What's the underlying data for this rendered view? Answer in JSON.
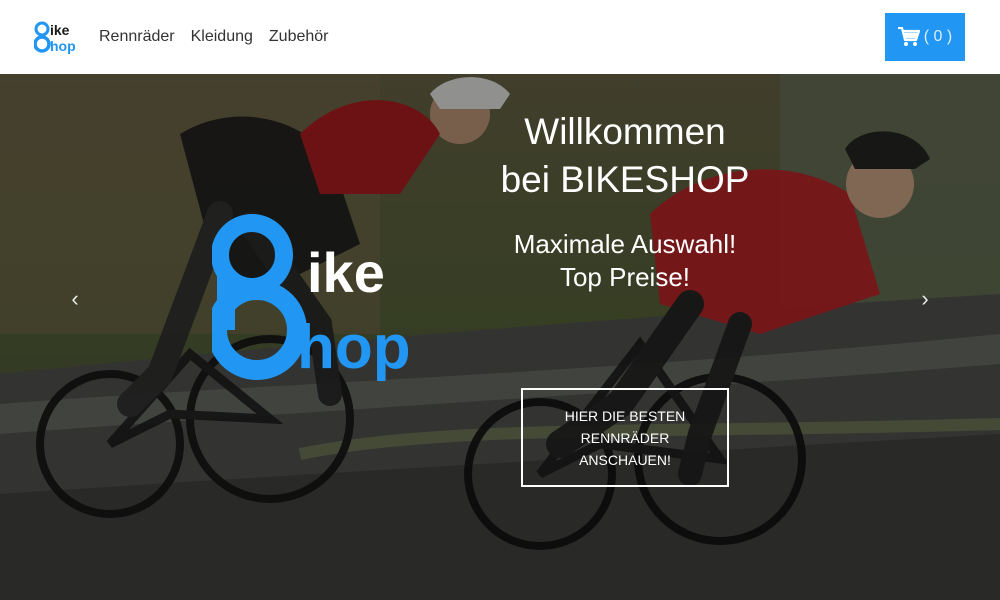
{
  "header": {
    "logo": {
      "text_line1": "ike",
      "text_line2": "hop",
      "icon": "bikeshop-logo-icon"
    },
    "nav": [
      {
        "label": "Rennräder"
      },
      {
        "label": "Kleidung"
      },
      {
        "label": "Zubehör"
      }
    ],
    "cart": {
      "icon": "shopping-cart-icon",
      "count_label": "( 0 )"
    }
  },
  "hero": {
    "logo": {
      "text_line1": "ike",
      "text_line2": "hop"
    },
    "title": "Willkommen bei BIKESHOP",
    "subtitle": "Maximale Auswahl! Top Preise!",
    "cta_label": "HIER DIE BESTEN RENNRÄDER ANSCHAUEN!",
    "prev_glyph": "‹",
    "next_glyph": "›"
  },
  "colors": {
    "brand_blue": "#2196f3",
    "nav_text": "#333333",
    "hero_text": "#ffffff"
  }
}
